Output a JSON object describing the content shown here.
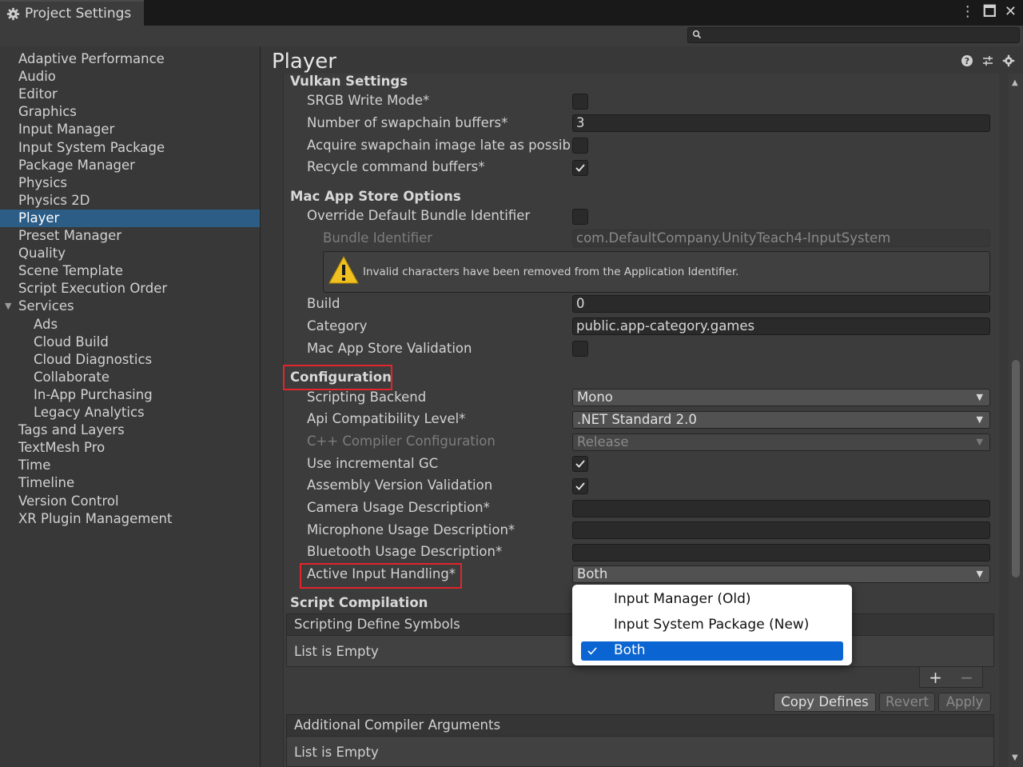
{
  "window": {
    "title": "Project Settings"
  },
  "colors": {
    "accent": "#2c5d87",
    "highlight_box": "#e0262c",
    "menu_selected": "#0a64d2"
  },
  "sidebar": {
    "items": [
      {
        "label": "Adaptive Performance",
        "indent": 0
      },
      {
        "label": "Audio",
        "indent": 0
      },
      {
        "label": "Editor",
        "indent": 0
      },
      {
        "label": "Graphics",
        "indent": 0
      },
      {
        "label": "Input Manager",
        "indent": 0
      },
      {
        "label": "Input System Package",
        "indent": 0
      },
      {
        "label": "Package Manager",
        "indent": 0
      },
      {
        "label": "Physics",
        "indent": 0
      },
      {
        "label": "Physics 2D",
        "indent": 0
      },
      {
        "label": "Player",
        "indent": 0,
        "selected": true
      },
      {
        "label": "Preset Manager",
        "indent": 0
      },
      {
        "label": "Quality",
        "indent": 0
      },
      {
        "label": "Scene Template",
        "indent": 0
      },
      {
        "label": "Script Execution Order",
        "indent": 0
      },
      {
        "label": "Services",
        "indent": 0,
        "expanded": true
      },
      {
        "label": "Ads",
        "indent": 1
      },
      {
        "label": "Cloud Build",
        "indent": 1
      },
      {
        "label": "Cloud Diagnostics",
        "indent": 1
      },
      {
        "label": "Collaborate",
        "indent": 1
      },
      {
        "label": "In-App Purchasing",
        "indent": 1
      },
      {
        "label": "Legacy Analytics",
        "indent": 1
      },
      {
        "label": "Tags and Layers",
        "indent": 0
      },
      {
        "label": "TextMesh Pro",
        "indent": 0
      },
      {
        "label": "Time",
        "indent": 0
      },
      {
        "label": "Timeline",
        "indent": 0
      },
      {
        "label": "Version Control",
        "indent": 0
      },
      {
        "label": "XR Plugin Management",
        "indent": 0
      }
    ]
  },
  "main": {
    "title": "Player",
    "vulkan": {
      "heading": "Vulkan Settings",
      "srgb_label": "SRGB Write Mode*",
      "srgb_checked": false,
      "swapchain_label": "Number of swapchain buffers*",
      "swapchain_value": "3",
      "acquire_label": "Acquire swapchain image late as possible*",
      "acquire_checked": false,
      "recycle_label": "Recycle command buffers*",
      "recycle_checked": true
    },
    "mac": {
      "heading": "Mac App Store Options",
      "override_label": "Override Default Bundle Identifier",
      "override_checked": false,
      "bundle_label": "Bundle Identifier",
      "bundle_value": "com.DefaultCompany.UnityTeach4-InputSystem",
      "warning": "Invalid characters have been removed from the Application Identifier.",
      "build_label": "Build",
      "build_value": "0",
      "category_label": "Category",
      "category_value": "public.app-category.games",
      "validation_label": "Mac App Store Validation",
      "validation_checked": false
    },
    "config": {
      "heading": "Configuration",
      "backend_label": "Scripting Backend",
      "backend_value": "Mono",
      "api_label": "Api Compatibility Level*",
      "api_value": ".NET Standard 2.0",
      "cpp_label": "C++ Compiler Configuration",
      "cpp_value": "Release",
      "gc_label": "Use incremental GC",
      "gc_checked": true,
      "assembly_label": "Assembly Version Validation",
      "assembly_checked": true,
      "camera_label": "Camera Usage Description*",
      "camera_value": "",
      "mic_label": "Microphone Usage Description*",
      "mic_value": "",
      "bt_label": "Bluetooth Usage Description*",
      "bt_value": "",
      "input_label": "Active Input Handling*",
      "input_value": "Both"
    },
    "compilation": {
      "heading": "Script Compilation",
      "defines_header": "Scripting Define Symbols",
      "defines_empty": "List is Empty",
      "copy_label": "Copy Defines",
      "revert_label": "Revert",
      "apply_label": "Apply",
      "args_header": "Additional Compiler Arguments",
      "args_empty": "List is Empty"
    }
  },
  "popup": {
    "options": [
      "Input Manager (Old)",
      "Input System Package (New)",
      "Both"
    ],
    "selected": "Both"
  }
}
